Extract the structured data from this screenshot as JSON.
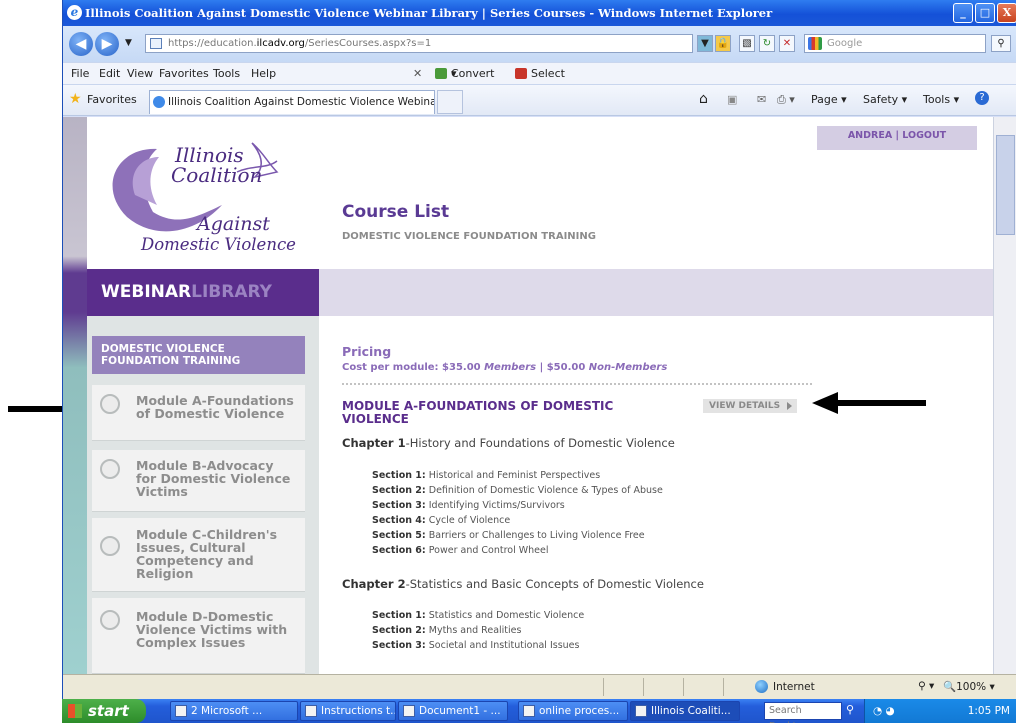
{
  "window": {
    "title": "Illinois Coalition Against Domestic Violence Webinar Library | Series Courses - Windows Internet Explorer",
    "url_prefix": "https://education.",
    "url_domain": "ilcadv.org",
    "url_path": "/SeriesCourses.aspx?s=1",
    "search_placeholder": "Google",
    "menu": [
      "File",
      "Edit",
      "View",
      "Favorites",
      "Tools",
      "Help"
    ],
    "convert_label": "Convert",
    "select_label": "Select",
    "favorites_label": "Favorites",
    "tab_title": "Illinois Coalition Against Domestic Violence Webinar Lib...",
    "command_bar": [
      "Page",
      "Safety",
      "Tools"
    ]
  },
  "site": {
    "logo": {
      "line1": "Illinois",
      "line2": "Coalition",
      "line3": "Against",
      "line4": "Domestic Violence"
    },
    "webinar_bold": "WEBINAR",
    "webinar_light": "LIBRARY",
    "user_name": "ANDREA",
    "user_sep": "|",
    "logout": "LOGOUT",
    "page_title": "Course List",
    "page_subtitle": "DOMESTIC VIOLENCE FOUNDATION TRAINING",
    "series_button": "DOMESTIC VIOLENCE FOUNDATION TRAINING",
    "modules": [
      {
        "title": "Module A-Foundations of Domestic Violence"
      },
      {
        "title": "Module B-Advocacy for Domestic Violence Victims"
      },
      {
        "title": "Module C-Children's Issues, Cultural Competency and Religion"
      },
      {
        "title": "Module D-Domestic Violence Victims with Complex Issues"
      }
    ],
    "pricing": {
      "heading": "Pricing",
      "cost_prefix": "Cost per module: $35.00 ",
      "members": "Members",
      "mid": " | $50.00 ",
      "non_members": "Non-Members"
    },
    "module_heading": "MODULE A-FOUNDATIONS OF DOMESTIC VIOLENCE",
    "view_details": "VIEW DETAILS",
    "chapters": [
      {
        "label": "Chapter 1",
        "title": "-History and Foundations of Domestic Violence",
        "sections": [
          {
            "label": "Section 1:",
            "title": " Historical and Feminist Perspectives"
          },
          {
            "label": "Section 2:",
            "title": " Definition of Domestic Violence & Types of Abuse"
          },
          {
            "label": "Section 3:",
            "title": " Identifying Victims/Survivors"
          },
          {
            "label": "Section 4:",
            "title": " Cycle of Violence"
          },
          {
            "label": "Section 5:",
            "title": " Barriers or Challenges to Living Violence Free"
          },
          {
            "label": "Section 6:",
            "title": " Power and Control Wheel"
          }
        ]
      },
      {
        "label": "Chapter 2",
        "title": "-Statistics and Basic Concepts of Domestic Violence",
        "sections": [
          {
            "label": "Section 1:",
            "title": " Statistics and Domestic Violence"
          },
          {
            "label": "Section 2:",
            "title": " Myths and Realities"
          },
          {
            "label": "Section 3:",
            "title": " Societal and Institutional Issues"
          }
        ]
      }
    ]
  },
  "status": {
    "zone": "Internet",
    "zoom": "100%"
  },
  "taskbar": {
    "start": "start",
    "items": [
      "2 Microsoft ...",
      "Instructions t...",
      "Document1 - ...",
      "online proces...",
      "Illinois Coaliti..."
    ],
    "search_placeholder": "Search Desktop",
    "clock": "1:05 PM"
  },
  "colors": {
    "brand_purple": "#5a2d8c",
    "light_purple": "#9482bc",
    "accent_text": "#8a6bb8"
  }
}
